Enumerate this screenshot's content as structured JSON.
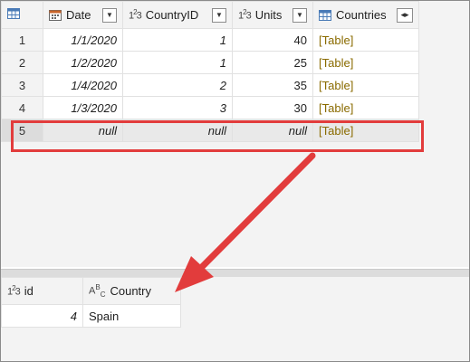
{
  "top_table": {
    "columns": [
      {
        "label": "Date",
        "icon": "calendar-icon"
      },
      {
        "label": "CountryID",
        "icon": "number-type-icon"
      },
      {
        "label": "Units",
        "icon": "number-type-icon"
      },
      {
        "label": "Countries",
        "icon": "table-type-icon"
      }
    ],
    "rows": [
      {
        "n": "1",
        "date": "1/1/2020",
        "cid": "1",
        "units": "40",
        "countries": "[Table]"
      },
      {
        "n": "2",
        "date": "1/2/2020",
        "cid": "1",
        "units": "25",
        "countries": "[Table]"
      },
      {
        "n": "3",
        "date": "1/4/2020",
        "cid": "2",
        "units": "35",
        "countries": "[Table]"
      },
      {
        "n": "4",
        "date": "1/3/2020",
        "cid": "3",
        "units": "30",
        "countries": "[Table]"
      },
      {
        "n": "5",
        "date": "null",
        "cid": "null",
        "units": "null",
        "countries": "[Table]"
      }
    ]
  },
  "bottom_table": {
    "columns": [
      {
        "label": "id",
        "icon": "number-type-icon"
      },
      {
        "label": "Country",
        "icon": "text-type-icon"
      }
    ],
    "rows": [
      {
        "id": "4",
        "country": "Spain"
      }
    ]
  },
  "colors": {
    "highlight": "#e23c3c",
    "table_link": "#8a6b00"
  }
}
